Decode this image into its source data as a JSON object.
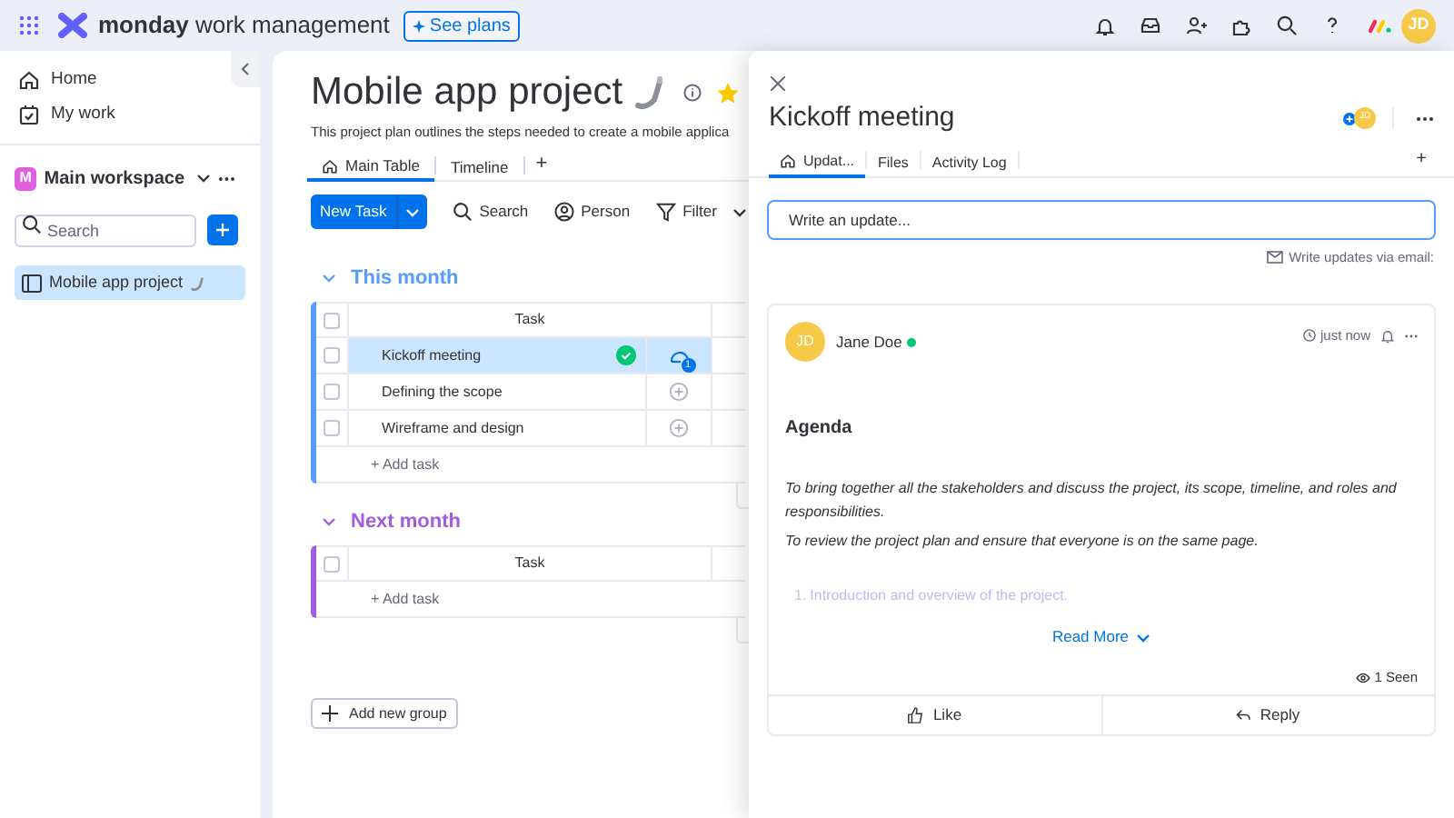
{
  "topbar": {
    "brand_bold": "monday",
    "brand_rest": "work management",
    "plans_button": "See plans",
    "avatar": "JD"
  },
  "sidebar": {
    "nav": [
      {
        "label": "Home",
        "kind": "home"
      },
      {
        "label": "My work",
        "kind": "mywork"
      }
    ],
    "workspace": {
      "badge": "M",
      "name": "Main workspace"
    },
    "search": {
      "placeholder": "Search"
    },
    "items": [
      {
        "label": "Mobile app project",
        "selected": true
      }
    ]
  },
  "board": {
    "title": "Mobile app project",
    "starred": true,
    "description": "This project plan outlines the steps needed to create a mobile applica",
    "tabs": [
      {
        "label": "Main Table",
        "selected": true
      },
      {
        "label": "Timeline",
        "selected": false
      }
    ],
    "add_view": "+",
    "toolbar": {
      "new_task": "New Task",
      "tools": [
        {
          "label": "Search",
          "kind": "search"
        },
        {
          "label": "Person",
          "kind": "person"
        },
        {
          "label": "Filter",
          "kind": "filter"
        }
      ]
    },
    "groups": [
      {
        "title": "This month",
        "color": "#579bfc",
        "column": "Task",
        "all_checked": false,
        "add_task": "+ Add task",
        "rows": [
          {
            "task": "Kickoff meeting",
            "checked": false,
            "selected": true,
            "done": true,
            "updates": "1"
          },
          {
            "task": "Defining the scope",
            "checked": false,
            "selected": false,
            "done": false
          },
          {
            "task": "Wireframe and design",
            "checked": false,
            "selected": false,
            "done": false
          }
        ]
      },
      {
        "title": "Next month",
        "color": "#a25ddc",
        "column": "Task",
        "all_checked": false,
        "add_task": "+ Add task"
      }
    ],
    "add_group": "Add new group"
  },
  "panel": {
    "title": "Kickoff meeting",
    "avatar": "JD",
    "tabs": [
      {
        "label": "Updat...",
        "selected": true
      },
      {
        "label": "Files",
        "selected": false
      },
      {
        "label": "Activity Log",
        "selected": false
      }
    ],
    "add_tab": "+",
    "update_field": {
      "placeholder": "Write an update..."
    },
    "email_link": "Write updates via email:",
    "post": {
      "avatar": "JD",
      "author": "Jane Doe",
      "online": true,
      "time": "just now",
      "heading": "Agenda",
      "paragraphs": [
        "To bring together all the stakeholders and discuss the project, its scope, timeline, and roles and responsibilities.",
        "To review the project plan and ensure that everyone is on the same page."
      ],
      "list": [
        {
          "number": "1.",
          "text": "Introduction and overview of the project."
        }
      ],
      "read_more": "Read More",
      "seen": "1 Seen",
      "actions": [
        {
          "label": "Like",
          "kind": "like"
        },
        {
          "label": "Reply",
          "kind": "reply"
        }
      ]
    }
  }
}
